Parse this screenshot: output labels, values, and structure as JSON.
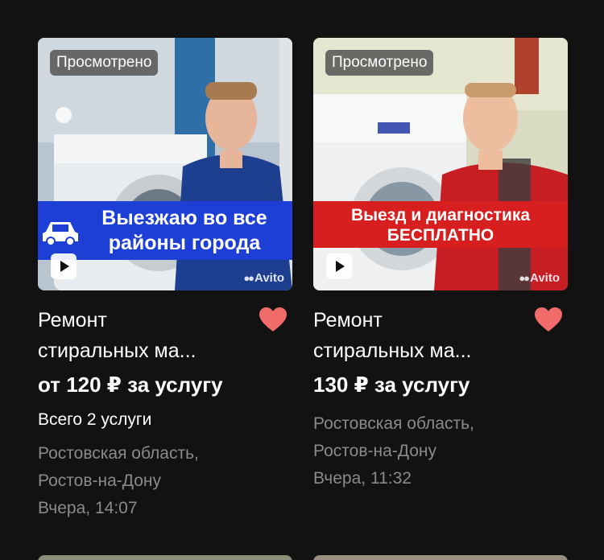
{
  "cards": [
    {
      "viewed_badge": "Просмотрено",
      "banner": {
        "line1": "Выезжаю во все",
        "line2": "районы города",
        "color": "#1d3fd6"
      },
      "watermark": "Avito",
      "title_line1": "Ремонт",
      "title_line2": "стиральных ма...",
      "price": "от 120 ₽ за услугу",
      "services": "Всего 2 услуги",
      "region": "Ростовская область,",
      "city": "Ростов-на-Дону",
      "date": "Вчера, 14:07",
      "favorite": true
    },
    {
      "viewed_badge": "Просмотрено",
      "banner": {
        "line1": "Выезд и диагностика",
        "line2": "БЕСПЛАТНО",
        "color": "#d81f1f"
      },
      "watermark": "Avito",
      "title_line1": "Ремонт",
      "title_line2": "стиральных ма...",
      "price": "130 ₽ за услугу",
      "region": "Ростовская область,",
      "city": "Ростов-на-Дону",
      "date": "Вчера, 11:32",
      "favorite": true
    }
  ],
  "colors": {
    "background": "#121212",
    "heart": "#f26b6b",
    "muted_text": "#8a8a8a"
  }
}
